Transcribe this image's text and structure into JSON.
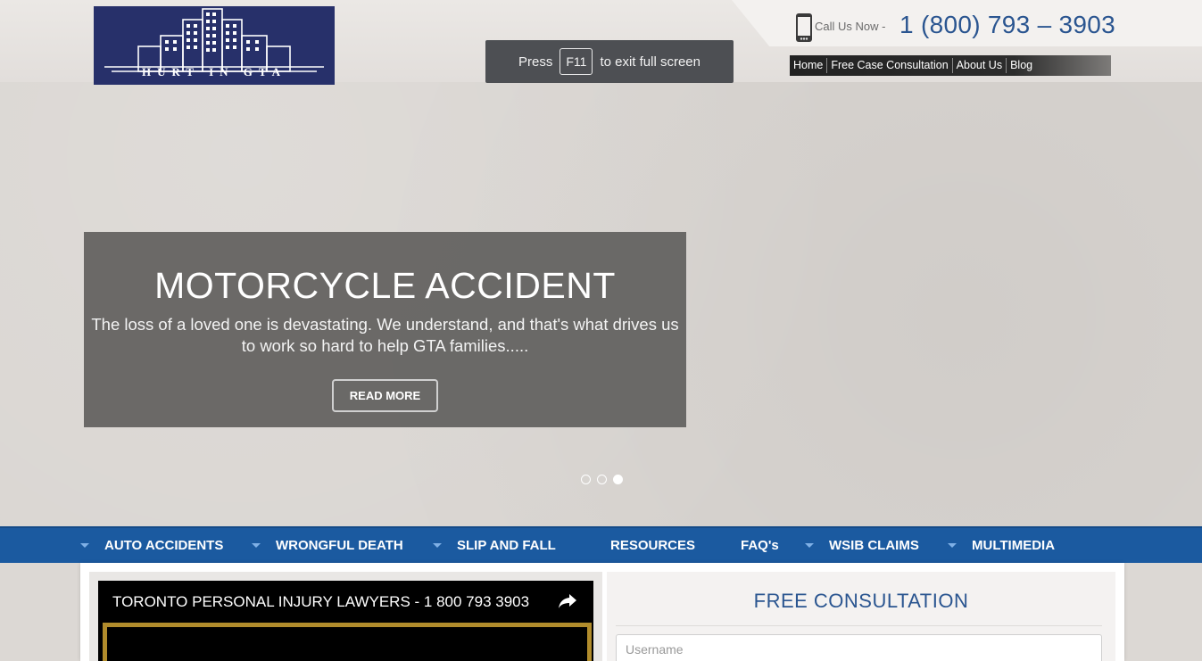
{
  "header": {
    "logo_text": "HURT IN GTA",
    "fullscreen_notice": {
      "press": "Press",
      "key": "F11",
      "rest": "to exit full screen"
    },
    "call_label": "Call Us Now -",
    "phone": "1 (800) 793 – 3903",
    "top_nav": [
      "Home",
      "Free Case Consultation",
      "About Us",
      "Blog"
    ]
  },
  "slider": {
    "title": "MOTORCYCLE ACCIDENT",
    "text": "The loss of a loved one is devastating. We understand, and that's what drives us to work so hard to help GTA families.....",
    "button": "READ MORE",
    "slide_count": 3,
    "active_slide": 3
  },
  "main_nav": [
    {
      "label": "AUTO ACCIDENTS",
      "dropdown": true
    },
    {
      "label": "WRONGFUL DEATH",
      "dropdown": true
    },
    {
      "label": "SLIP AND FALL",
      "dropdown": true
    },
    {
      "label": "RESOURCES",
      "dropdown": false
    },
    {
      "label": "FAQ's",
      "dropdown": false
    },
    {
      "label": "WSIB CLAIMS",
      "dropdown": true
    },
    {
      "label": "MULTIMEDIA",
      "dropdown": true
    }
  ],
  "video": {
    "title": "TORONTO PERSONAL INJURY LAWYERS - 1 800 793 3903",
    "share_icon": "share-arrow-icon"
  },
  "consultation": {
    "title": "FREE CONSULTATION",
    "username_placeholder": "Username"
  },
  "colors": {
    "brand_navy": "#27306a",
    "nav_blue": "#1b5aa0",
    "phone_blue": "#2a5590",
    "video_border_gold": "#b18c2c"
  }
}
